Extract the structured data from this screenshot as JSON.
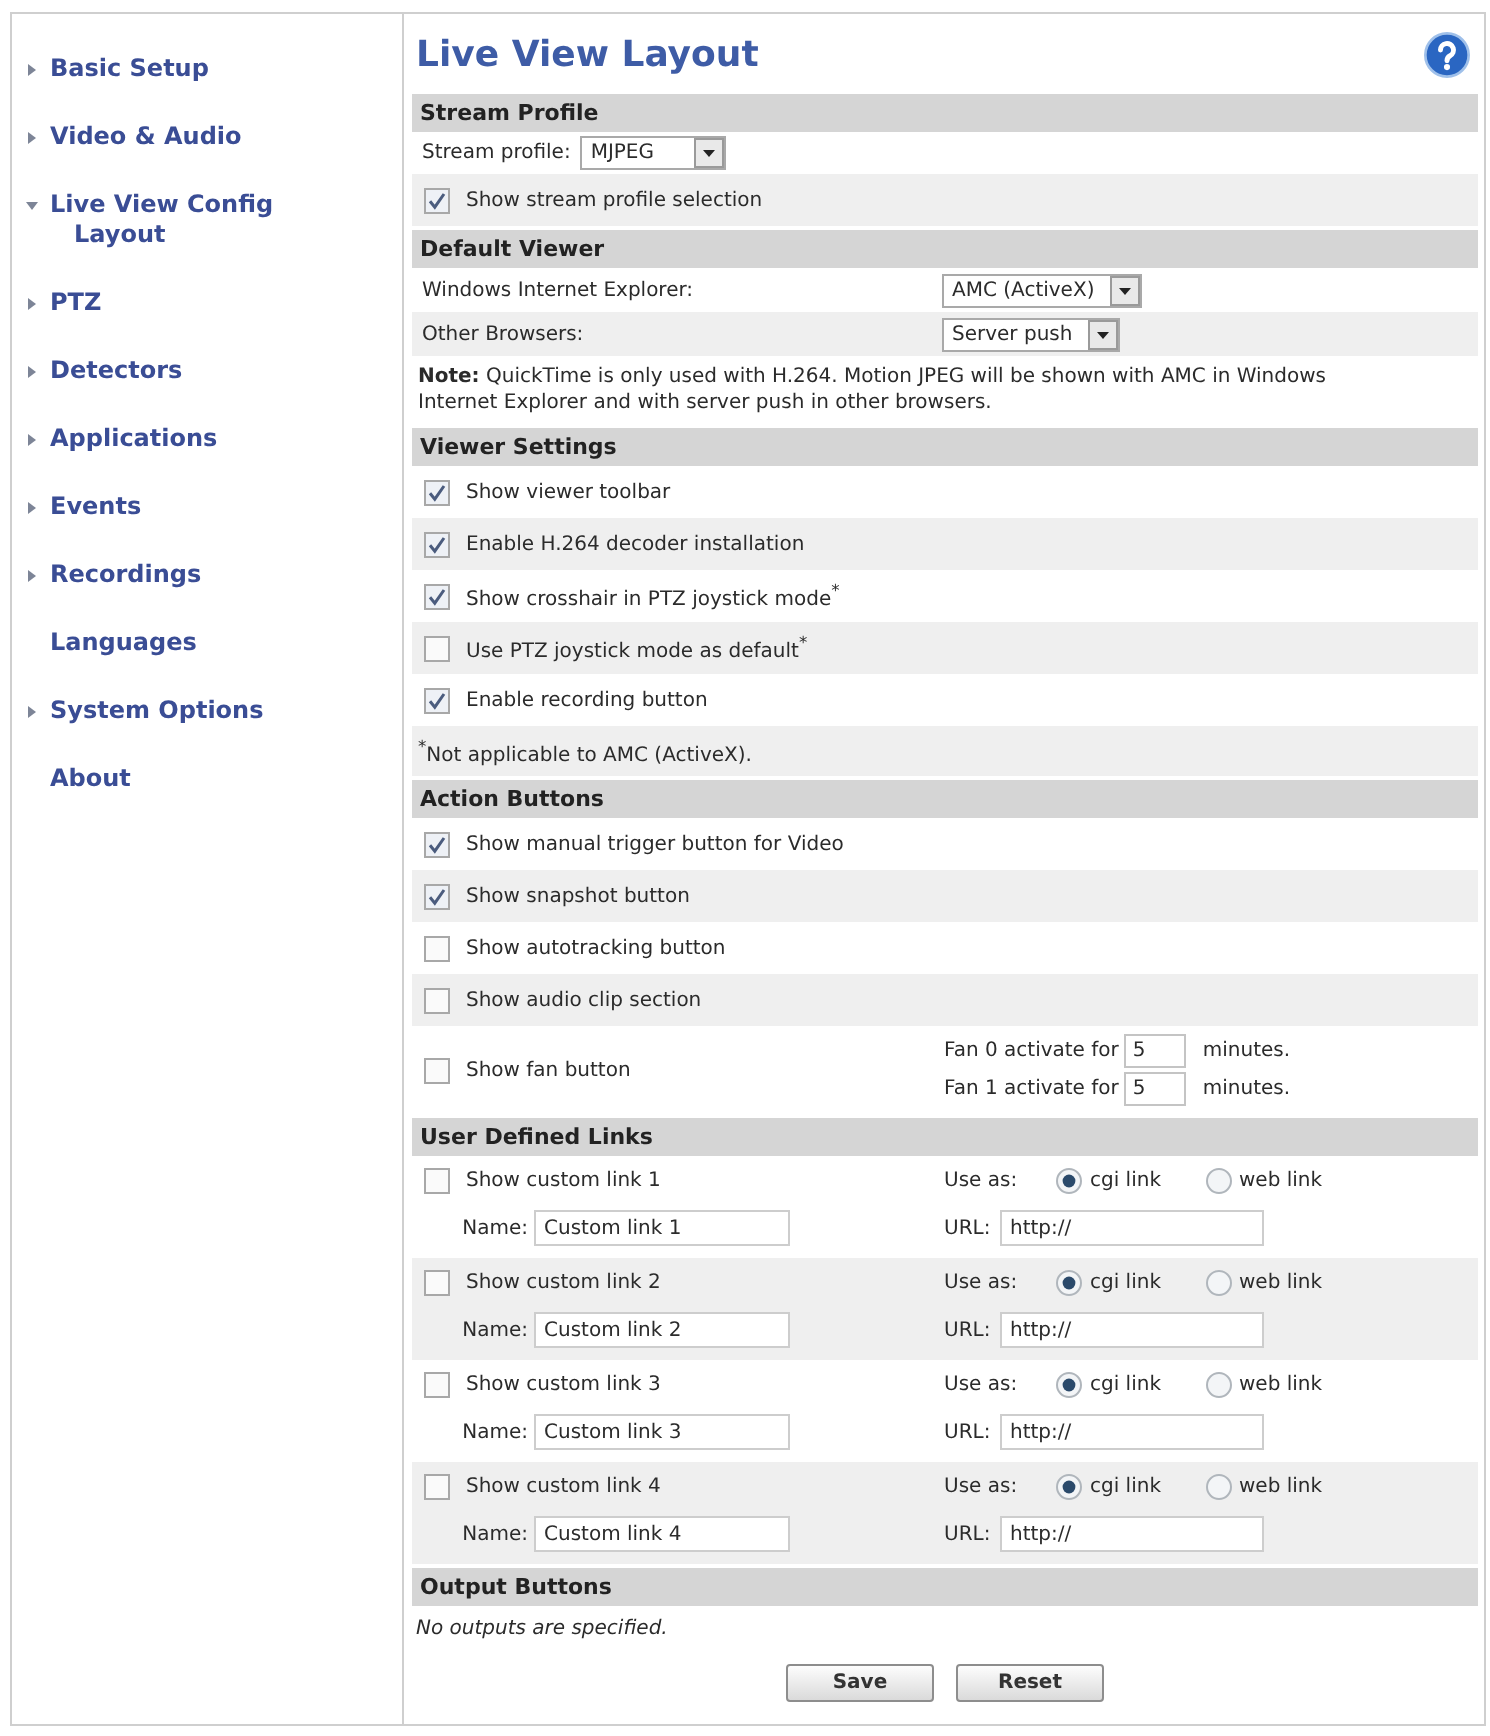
{
  "sidebar": {
    "items": [
      {
        "label": "Basic Setup",
        "kind": "group",
        "expanded": false
      },
      {
        "label": "Video & Audio",
        "kind": "group",
        "expanded": false
      },
      {
        "label": "Live View Config",
        "kind": "group",
        "expanded": true,
        "children": [
          {
            "label": "Layout"
          }
        ]
      },
      {
        "label": "PTZ",
        "kind": "group",
        "expanded": false
      },
      {
        "label": "Detectors",
        "kind": "group",
        "expanded": false
      },
      {
        "label": "Applications",
        "kind": "group",
        "expanded": false
      },
      {
        "label": "Events",
        "kind": "group",
        "expanded": false
      },
      {
        "label": "Recordings",
        "kind": "group",
        "expanded": false
      },
      {
        "label": "Languages",
        "kind": "page"
      },
      {
        "label": "System Options",
        "kind": "group",
        "expanded": false
      },
      {
        "label": "About",
        "kind": "page"
      }
    ]
  },
  "page": {
    "title": "Live View Layout"
  },
  "sections": [
    {
      "title": "Stream Profile",
      "rows": [
        {
          "kind": "inline-select",
          "label": "Stream profile:",
          "value": "MJPEG"
        },
        {
          "kind": "checkbox",
          "label": "Show stream profile selection",
          "checked": true
        }
      ]
    },
    {
      "title": "Default Viewer",
      "rows": [
        {
          "kind": "select",
          "label": "Windows Internet Explorer:",
          "value": "AMC (ActiveX)"
        },
        {
          "kind": "select",
          "label": "Other Browsers:",
          "value": "Server push"
        },
        {
          "kind": "note",
          "text": "**Note:** QuickTime is only used with H.264. Motion JPEG will be shown with AMC in Windows Internet Explorer and with server push in other browsers."
        }
      ]
    },
    {
      "title": "Viewer Settings",
      "rows": [
        {
          "kind": "checkbox",
          "label": "Show viewer toolbar",
          "checked": true
        },
        {
          "kind": "checkbox",
          "label": "Enable H.264 decoder installation",
          "checked": true
        },
        {
          "kind": "checkbox",
          "label": "Show crosshair in PTZ joystick mode$^{*}$",
          "checked": true
        },
        {
          "kind": "checkbox",
          "label": "Use PTZ joystick mode as default$^{*}$",
          "checked": false
        },
        {
          "kind": "checkbox",
          "label": "Enable recording button",
          "checked": true
        },
        {
          "kind": "note",
          "text": "$^{*}$Not applicable to AMC (ActiveX)."
        }
      ]
    },
    {
      "title": "Action Buttons",
      "rows": [
        {
          "kind": "checkbox",
          "label": "Show manual trigger button for Video",
          "checked": true
        },
        {
          "kind": "checkbox",
          "label": "Show snapshot button",
          "checked": true
        },
        {
          "kind": "checkbox",
          "label": "Show autotracking button",
          "checked": false
        },
        {
          "kind": "checkbox",
          "label": "Show audio clip section",
          "checked": false
        },
        {
          "kind": "fan",
          "label": "Show fan button",
          "checked": false,
          "timers": [
            {
              "label": "Fan 0 activate for",
              "value": "5",
              "unit": "minutes."
            },
            {
              "label": "Fan 1 activate for",
              "value": "5",
              "unit": "minutes."
            }
          ]
        }
      ]
    },
    {
      "title": "User Defined Links",
      "rows": [
        {
          "kind": "link",
          "label": "Show custom link 1",
          "checked": false,
          "use_as_label": "Use as:",
          "options": [
            {
              "label": "cgi link",
              "selected": true
            },
            {
              "label": "web link",
              "selected": false
            }
          ],
          "name_label": "Name:",
          "name": "Custom link 1",
          "url_label": "URL:",
          "url": "http://"
        },
        {
          "kind": "link",
          "label": "Show custom link 2",
          "checked": false,
          "use_as_label": "Use as:",
          "options": [
            {
              "label": "cgi link",
              "selected": true
            },
            {
              "label": "web link",
              "selected": false
            }
          ],
          "name_label": "Name:",
          "name": "Custom link 2",
          "url_label": "URL:",
          "url": "http://"
        },
        {
          "kind": "link",
          "label": "Show custom link 3",
          "checked": false,
          "use_as_label": "Use as:",
          "options": [
            {
              "label": "cgi link",
              "selected": true
            },
            {
              "label": "web link",
              "selected": false
            }
          ],
          "name_label": "Name:",
          "name": "Custom link 3",
          "url_label": "URL:",
          "url": "http://"
        },
        {
          "kind": "link",
          "label": "Show custom link 4",
          "checked": false,
          "use_as_label": "Use as:",
          "options": [
            {
              "label": "cgi link",
              "selected": true
            },
            {
              "label": "web link",
              "selected": false
            }
          ],
          "name_label": "Name:",
          "name": "Custom link 4",
          "url_label": "URL:",
          "url": "http://"
        }
      ]
    },
    {
      "title": "Output Buttons",
      "rows": [
        {
          "kind": "message",
          "text": "No outputs are specified."
        }
      ]
    }
  ],
  "buttons": [
    "Save",
    "Reset"
  ]
}
